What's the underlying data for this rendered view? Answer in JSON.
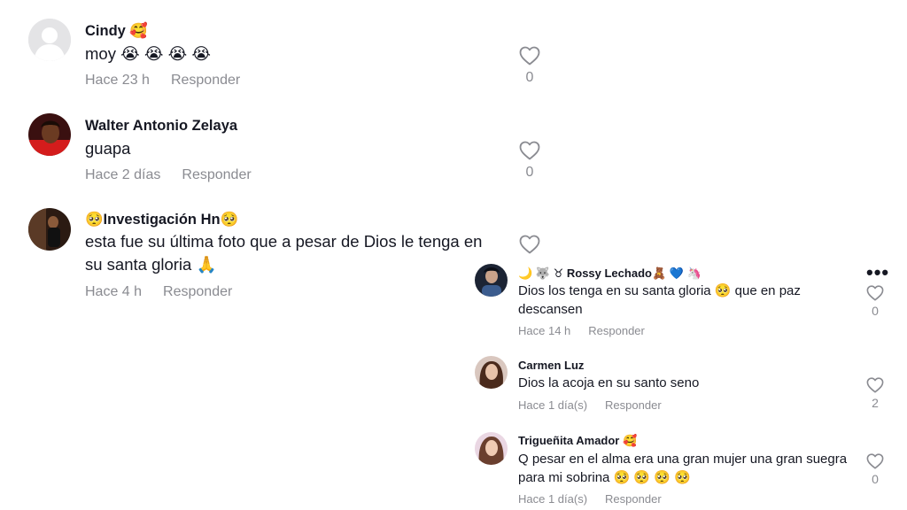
{
  "comments": [
    {
      "author": "Cindy 🥰",
      "text": "moy 😭 😭 😭 😭",
      "time": "Hace 23 h",
      "reply_label": "Responder",
      "likes": "0",
      "avatar": "default-avatar"
    },
    {
      "author": "Walter Antonio Zelaya",
      "text": "guapa",
      "time": "Hace 2 días",
      "reply_label": "Responder",
      "likes": "0",
      "avatar": "photo-avatar"
    },
    {
      "author": "🥺Investigación Hn🥺",
      "text": "esta fue su última foto que a pesar de Dios le tenga en su santa gloria 🙏",
      "time": "Hace 4 h",
      "reply_label": "Responder",
      "avatar": "photo-avatar"
    }
  ],
  "replies": [
    {
      "author": "🌙 🐺 ♉ Rossy Lechado🧸 💙 🦄",
      "text": "Dios los tenga en su santa gloria 🥺  que en paz descansen",
      "time": "Hace 14 h",
      "reply_label": "Responder",
      "likes": "0",
      "avatar": "photo-avatar"
    },
    {
      "author": "Carmen Luz",
      "text": "Dios la acoja en su santo seno",
      "time": "Hace 1 día(s)",
      "reply_label": "Responder",
      "likes": "2",
      "avatar": "photo-avatar"
    },
    {
      "author": "Trigueñita Amador 🥰",
      "text": "Q pesar en el alma era una gran mujer una gran suegra para mi sobrina 🥺 🥺 🥺 🥺",
      "time": "Hace 1 día(s)",
      "reply_label": "Responder",
      "likes": "0",
      "avatar": "photo-avatar"
    }
  ],
  "more_label": "•••",
  "colors": {
    "text": "#161823",
    "secondary": "#8a8b91",
    "heart": "#8a8b91",
    "background": "#ffffff"
  },
  "icons": {
    "like": "heart-outline-icon",
    "more": "more-options-icon"
  }
}
